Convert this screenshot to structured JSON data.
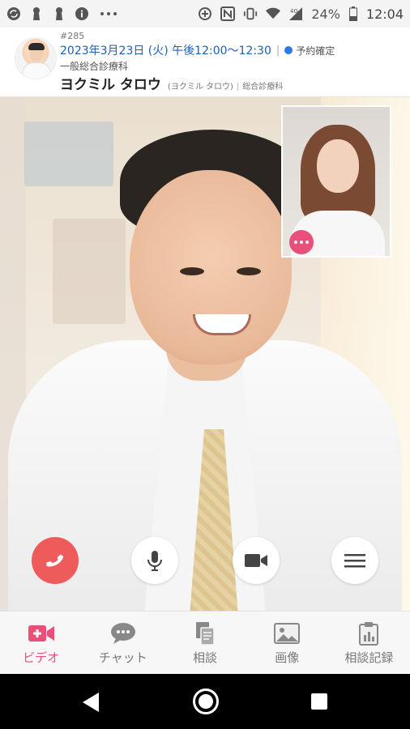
{
  "status_bar": {
    "battery": "24%",
    "time": "12:04",
    "icons": [
      "sync-icon",
      "keyhole-icon",
      "keyhole-icon",
      "info-icon",
      "more-dots-icon",
      "data-saver-icon",
      "nfc-icon",
      "vibrate-icon",
      "wifi-icon",
      "signal-icon",
      "battery-icon"
    ]
  },
  "appointment": {
    "id": "#285",
    "datetime": "2023年3月23日 (火) 午後12:00～12:30",
    "status": "予約確定",
    "status_color": "#2c7be5",
    "department": "一般総合診療科",
    "patient_name": "ヨクミル タロウ",
    "patient_kana": "(ヨクミル タロウ)",
    "patient_department": "総合診療科"
  },
  "call_controls": {
    "end_color": "#ef5b5b",
    "buttons": [
      "end-call",
      "microphone",
      "camera",
      "menu"
    ]
  },
  "tabs": [
    {
      "label": "ビデオ",
      "icon": "video-icon",
      "active": true
    },
    {
      "label": "チャット",
      "icon": "chat-icon",
      "active": false
    },
    {
      "label": "相談",
      "icon": "documents-icon",
      "active": false
    },
    {
      "label": "画像",
      "icon": "image-icon",
      "active": false
    },
    {
      "label": "相談記録",
      "icon": "record-icon",
      "active": false
    }
  ],
  "accent_color": "#e8507a"
}
